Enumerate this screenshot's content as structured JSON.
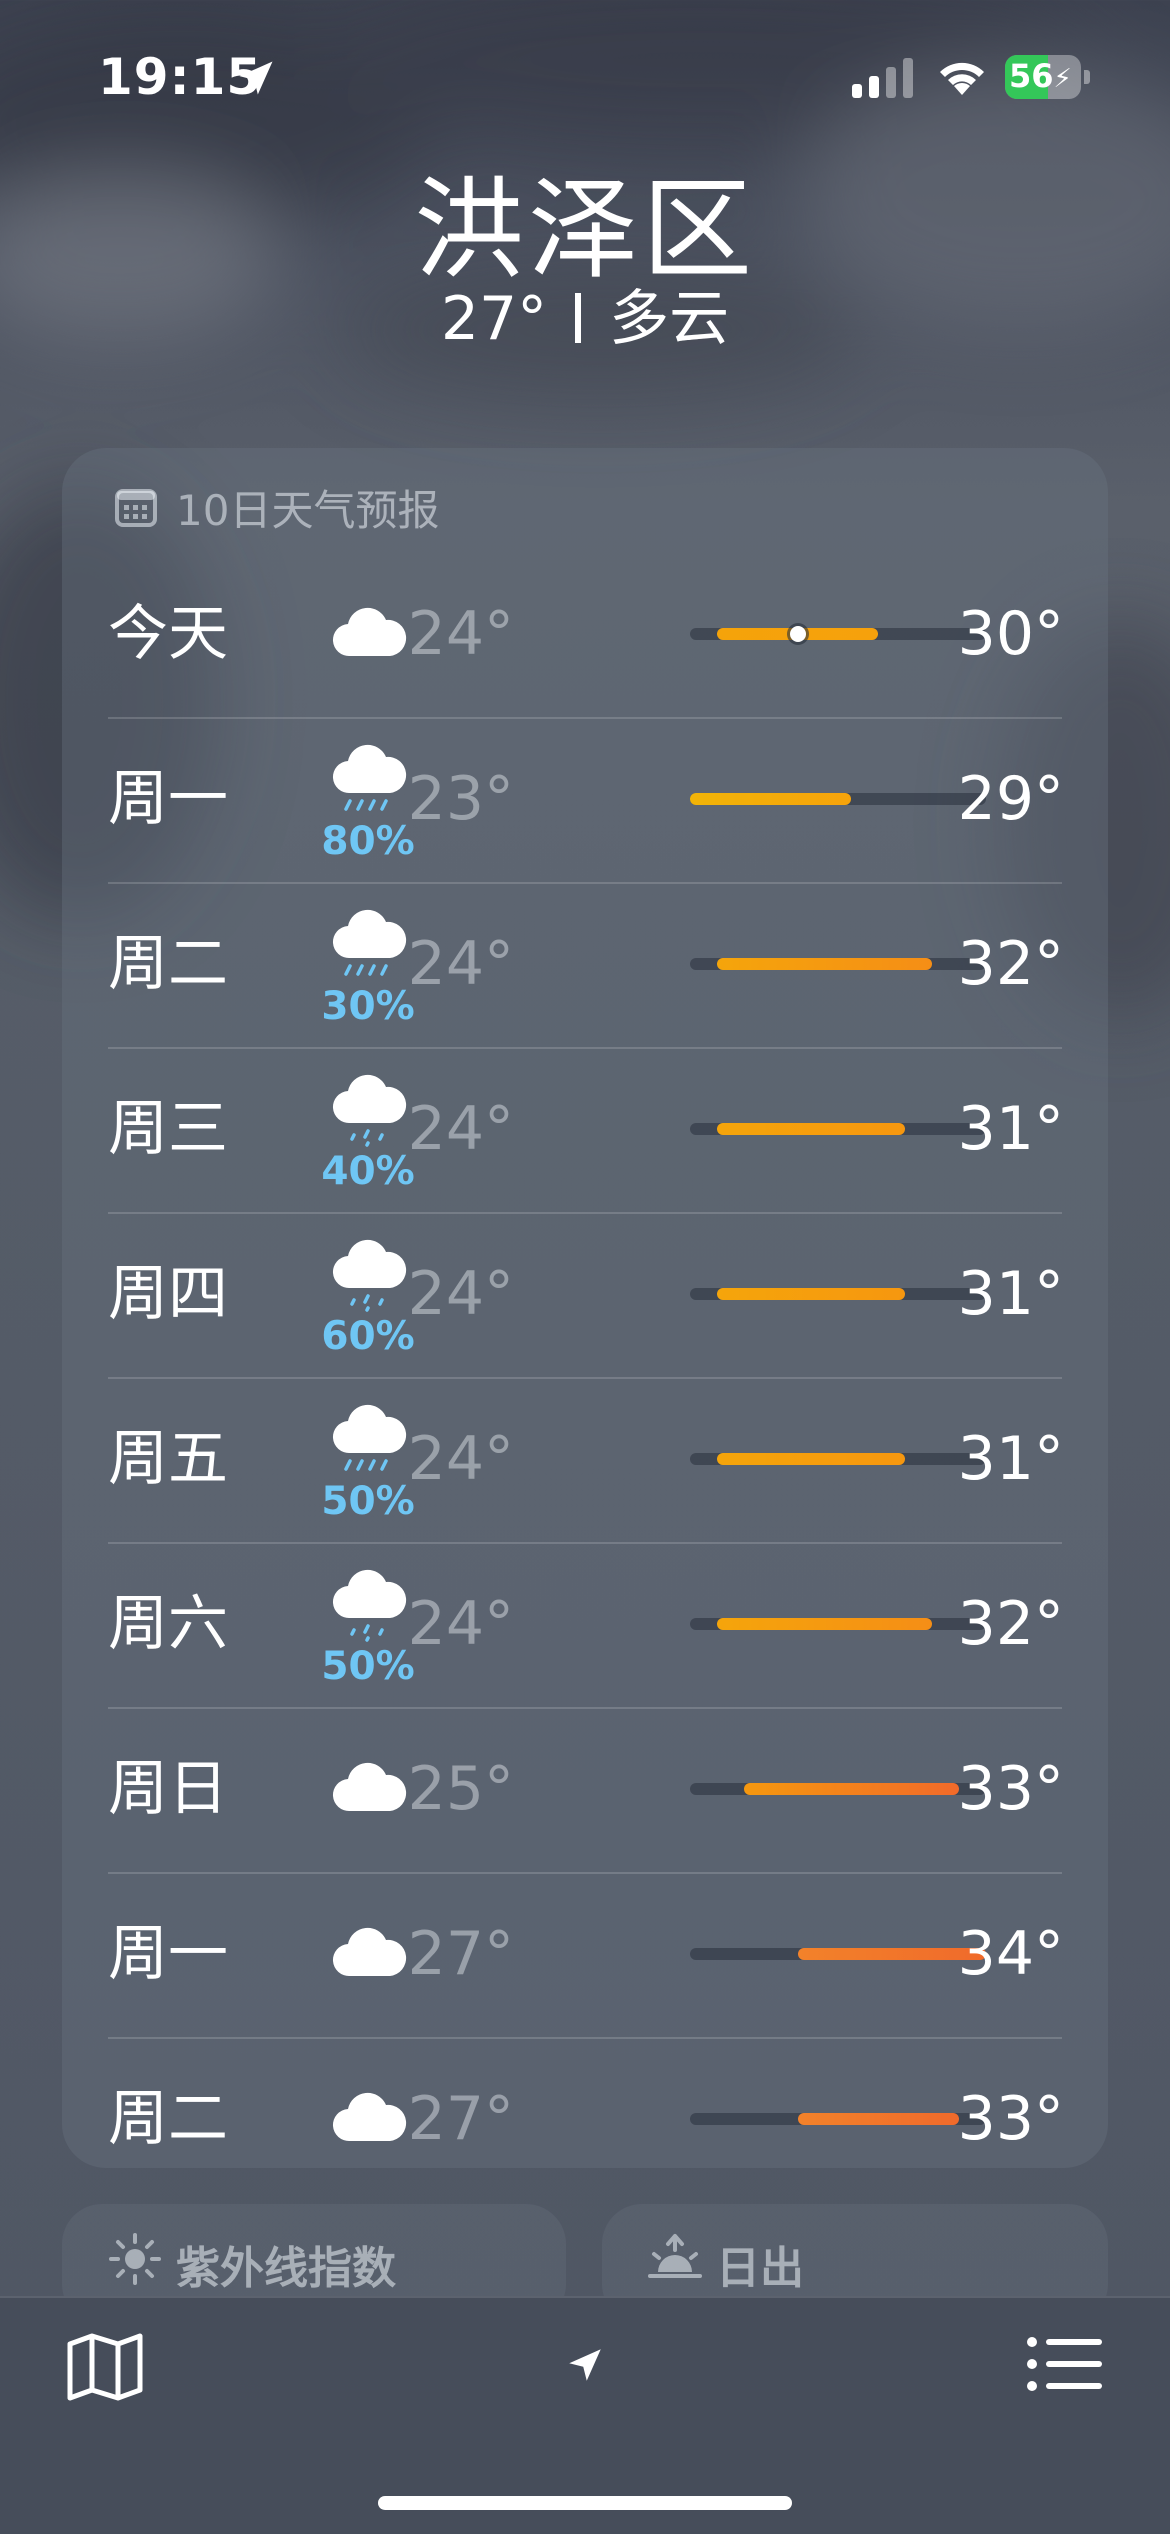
{
  "status_bar": {
    "time": "19:15",
    "battery_text": "56",
    "battery_level": 0.56
  },
  "header": {
    "city": "洪泽区",
    "temperature": "27°",
    "condition": "多云"
  },
  "forecast": {
    "title": "10日天气预报",
    "range_min": 23,
    "range_max": 34,
    "days": [
      {
        "day": "今天",
        "icon": "cloud-icon",
        "pop": "",
        "low": "24°",
        "high": "30°",
        "low_v": 24,
        "high_v": 30,
        "current": 27,
        "color_a": "#f5a30a",
        "color_b": "#f6a10c"
      },
      {
        "day": "周一",
        "icon": "cloud-rain-icon",
        "pop": "80%",
        "low": "23°",
        "high": "29°",
        "low_v": 23,
        "high_v": 29,
        "color_a": "#f2b408",
        "color_b": "#f6a30b"
      },
      {
        "day": "周二",
        "icon": "cloud-rain-icon",
        "pop": "30%",
        "low": "24°",
        "high": "32°",
        "low_v": 24,
        "high_v": 32,
        "color_a": "#f5a50b",
        "color_b": "#f58e16"
      },
      {
        "day": "周三",
        "icon": "cloud-drizzle-icon",
        "pop": "40%",
        "low": "24°",
        "high": "31°",
        "low_v": 24,
        "high_v": 31,
        "color_a": "#f5a50b",
        "color_b": "#f6970f"
      },
      {
        "day": "周四",
        "icon": "cloud-drizzle-icon",
        "pop": "60%",
        "low": "24°",
        "high": "31°",
        "low_v": 24,
        "high_v": 31,
        "color_a": "#f5a50b",
        "color_b": "#f6970f"
      },
      {
        "day": "周五",
        "icon": "cloud-rain-icon",
        "pop": "50%",
        "low": "24°",
        "high": "31°",
        "low_v": 24,
        "high_v": 31,
        "color_a": "#f5a50b",
        "color_b": "#f6970f"
      },
      {
        "day": "周六",
        "icon": "cloud-drizzle-icon",
        "pop": "50%",
        "low": "24°",
        "high": "32°",
        "low_v": 24,
        "high_v": 32,
        "color_a": "#f5a50b",
        "color_b": "#f58e16"
      },
      {
        "day": "周日",
        "icon": "cloud-icon",
        "pop": "",
        "low": "25°",
        "high": "33°",
        "low_v": 25,
        "high_v": 33,
        "color_a": "#f5980f",
        "color_b": "#f26a2a"
      },
      {
        "day": "周一",
        "icon": "cloud-icon",
        "pop": "",
        "low": "27°",
        "high": "34°",
        "low_v": 27,
        "high_v": 34,
        "color_a": "#f3822a",
        "color_b": "#f06a2b"
      },
      {
        "day": "周二",
        "icon": "cloud-icon",
        "pop": "",
        "low": "27°",
        "high": "33°",
        "low_v": 27,
        "high_v": 33,
        "color_a": "#f3822a",
        "color_b": "#f06a2b"
      }
    ]
  },
  "mini_cards": {
    "uv_label": "紫外线指数",
    "sunrise_label": "日出"
  },
  "colors": {
    "precip": "#6fc6f4",
    "battery_green": "#34c759"
  }
}
